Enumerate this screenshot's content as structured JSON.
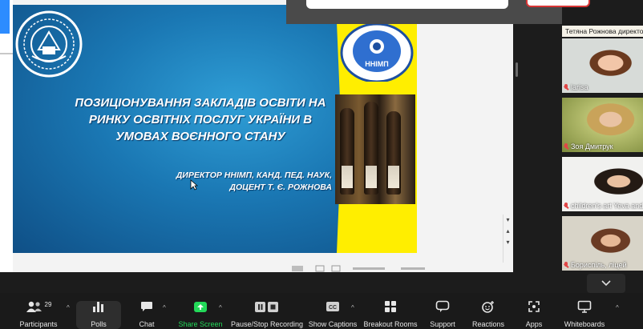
{
  "slide": {
    "title": "ПОЗИЦІОНУВАННЯ ЗАКЛАДІВ ОСВІТИ НА РИНКУ ОСВІТНІХ ПОСЛУГ УКРАЇНИ В УМОВАХ ВОЄННОГО СТАНУ",
    "title_lines": [
      "ПОЗИЦІОНУВАННЯ ЗАКЛАДІВ ОСВІТИ НА",
      "РИНКУ ОСВІТНІХ ПОСЛУГ УКРАЇНИ В",
      "УМОВАХ ВОЄННОГО СТАНУ"
    ],
    "author_lines": [
      "ДИРЕКТОР ННІМП, КАНД. ПЕД. НАУК,",
      "ДОЦЕНТ Т. Є. РОЖНОВА"
    ],
    "logo_right_text": "ННІМП",
    "colors": {
      "slide_blue": "#1a77b3",
      "yellow": "#ffee00"
    }
  },
  "participants_panel": {
    "top_name": "Тетяна Рожнова директо",
    "tiles": [
      {
        "name": "larisa"
      },
      {
        "name": "Зоя Дмитрук"
      },
      {
        "name": "children's art Yeva and"
      },
      {
        "name": "Бориспіль, ліцей"
      }
    ],
    "collapse_icon": "chevron-down-icon"
  },
  "toolbar": {
    "participants": {
      "label": "Participants",
      "count": "29",
      "icon": "people-icon"
    },
    "polls": {
      "label": "Polls",
      "icon": "bar-chart-icon"
    },
    "chat": {
      "label": "Chat",
      "icon": "chat-bubble-icon"
    },
    "share_screen": {
      "label": "Share Screen",
      "icon": "share-up-arrow-icon",
      "color": "#23d959"
    },
    "recording": {
      "label": "Pause/Stop Recording",
      "icon": "pause-stop-icon"
    },
    "captions": {
      "label": "Show Captions",
      "icon": "cc-icon",
      "badge": "CC"
    },
    "breakout": {
      "label": "Breakout Rooms",
      "icon": "grid-icon"
    },
    "support": {
      "label": "Support",
      "icon": "support-icon"
    },
    "reactions": {
      "label": "Reactions",
      "icon": "emoji-plus-icon"
    },
    "apps": {
      "label": "Apps",
      "icon": "apps-icon"
    },
    "whiteboards": {
      "label": "Whiteboards",
      "icon": "whiteboard-icon"
    }
  }
}
